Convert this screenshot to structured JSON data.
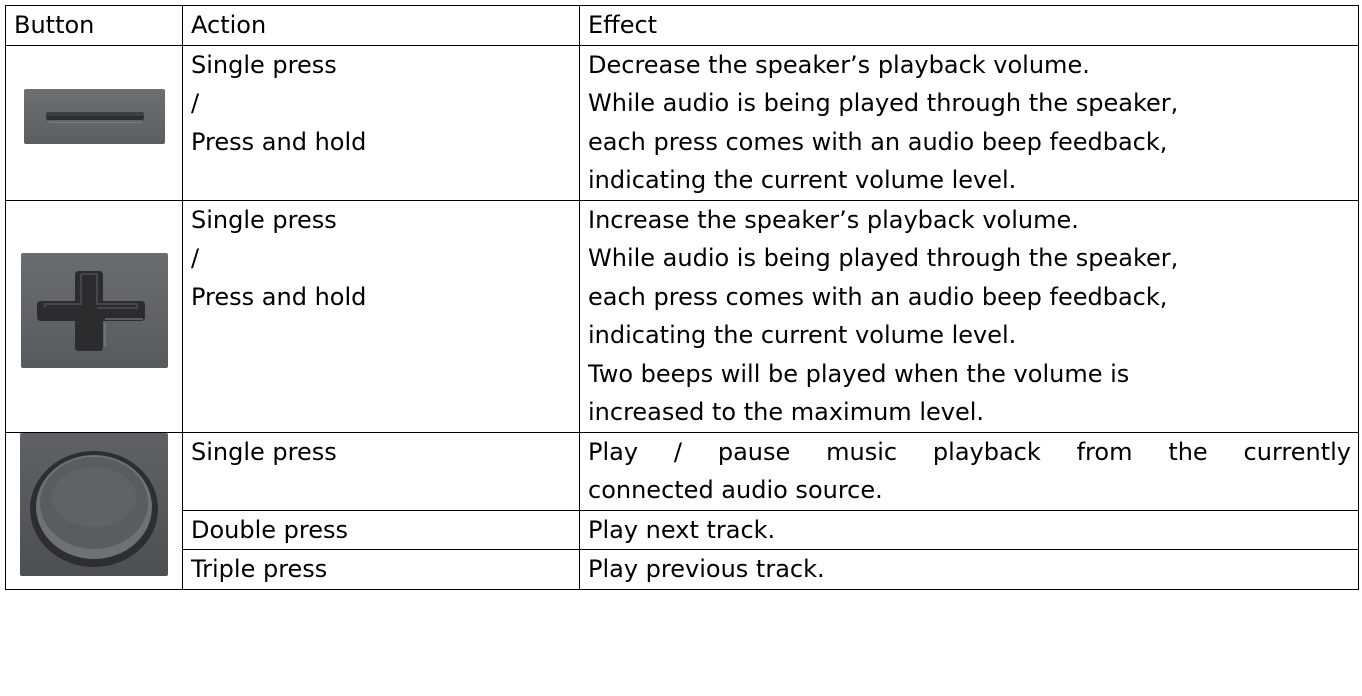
{
  "table": {
    "headers": {
      "button": "Button",
      "action": "Action",
      "effect": "Effect"
    },
    "rows": [
      {
        "button_icon": "minus-button-icon",
        "action_lines": [
          "Single press",
          "/",
          "Press and hold"
        ],
        "effect_lines": [
          "Decrease the speaker’s playback volume.",
          "While audio is being played through the speaker,",
          "each press comes with an audio beep feedback,",
          "indicating the current volume level."
        ]
      },
      {
        "button_icon": "plus-button-icon",
        "action_lines": [
          "Single press",
          "/",
          "Press and hold"
        ],
        "effect_lines": [
          "Increase the speaker’s playback volume.",
          "While audio is being played through the speaker,",
          "each press comes with an audio beep feedback,",
          "indicating the current volume level.",
          "Two beeps will be played when the volume is",
          "increased to the maximum level."
        ]
      },
      {
        "button_icon": "play-pause-button-icon",
        "sub_rows": [
          {
            "action": "Single press",
            "effect_lines": [
              "Play / pause music playback from the currently",
              "connected audio source."
            ]
          },
          {
            "action": "Double press",
            "effect_lines": [
              "Play next track."
            ]
          },
          {
            "action": "Triple press",
            "effect_lines": [
              "Play previous track."
            ]
          }
        ]
      }
    ]
  }
}
